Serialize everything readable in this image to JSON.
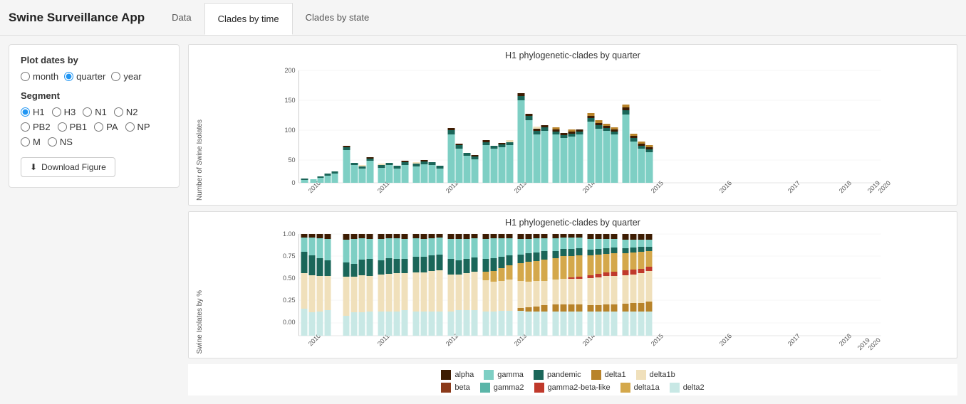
{
  "app": {
    "title": "Swine Surveillance App"
  },
  "navbar": {
    "tabs": [
      {
        "label": "Data",
        "active": false
      },
      {
        "label": "Clades by time",
        "active": true
      },
      {
        "label": "Clades by state",
        "active": false
      }
    ]
  },
  "left_panel": {
    "plot_dates_label": "Plot dates by",
    "date_options": [
      "month",
      "quarter",
      "year"
    ],
    "date_selected": "quarter",
    "segment_label": "Segment",
    "segment_options": [
      "H1",
      "H3",
      "N1",
      "N2",
      "PB2",
      "PB1",
      "PA",
      "NP",
      "M",
      "NS"
    ],
    "segment_selected": "H1",
    "download_button": "Download Figure"
  },
  "charts": {
    "top": {
      "title": "H1 phylogenetic-clades by quarter",
      "y_label": "Number of Swine Isolates"
    },
    "bottom": {
      "title": "H1 phylogenetic-clades by quarter",
      "y_label": "Swine Isolates by %"
    }
  },
  "legend": {
    "items": [
      {
        "label": "alpha",
        "color": "#3d1c02"
      },
      {
        "label": "gamma",
        "color": "#7ecfc4"
      },
      {
        "label": "pandemic",
        "color": "#1a6659"
      },
      {
        "label": "delta1",
        "color": "#b8832a"
      },
      {
        "label": "delta1b",
        "color": "#f0e0bb"
      },
      {
        "label": "beta",
        "color": "#8b3a1a"
      },
      {
        "label": "gamma2",
        "color": "#5bb5a8"
      },
      {
        "label": "gamma2-beta-like",
        "color": "#c0392b"
      },
      {
        "label": "delta1a",
        "color": "#d4a84b"
      },
      {
        "label": "delta2",
        "color": "#c8e8e5"
      }
    ]
  }
}
